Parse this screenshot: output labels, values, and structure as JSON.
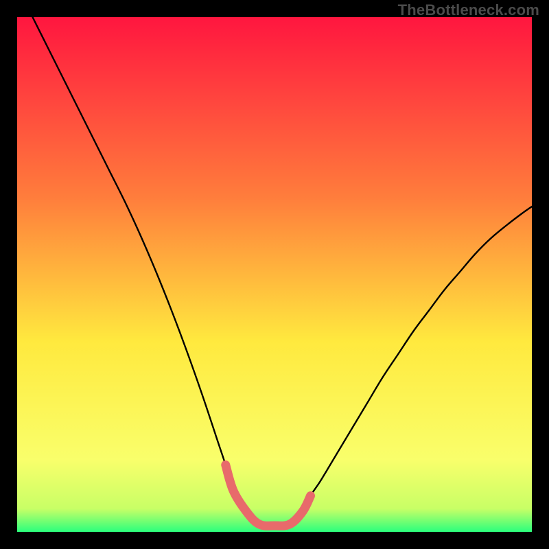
{
  "watermark": "TheBottleneck.com",
  "colors": {
    "background": "#000000",
    "gradient_top": "#ff163f",
    "gradient_mid1": "#ff7d3c",
    "gradient_mid2": "#ffe93e",
    "gradient_mid3": "#f9ff6b",
    "gradient_bottom": "#2bff7d",
    "curve": "#000000",
    "highlight": "#e86a6b",
    "watermark_text": "#4b4b4b"
  },
  "chart_data": {
    "type": "line",
    "title": "",
    "xlabel": "",
    "ylabel": "",
    "xlim": [
      0,
      1
    ],
    "ylim": [
      0,
      1
    ],
    "categories": [],
    "series": [
      {
        "name": "bottleneck-curve",
        "x": [
          0.03,
          0.06,
          0.09,
          0.12,
          0.15,
          0.18,
          0.21,
          0.24,
          0.27,
          0.3,
          0.33,
          0.36,
          0.39,
          0.405,
          0.42,
          0.445,
          0.47,
          0.5,
          0.53,
          0.555,
          0.57,
          0.59,
          0.62,
          0.65,
          0.68,
          0.71,
          0.74,
          0.77,
          0.8,
          0.83,
          0.86,
          0.89,
          0.92,
          0.95,
          0.98,
          1.0
        ],
        "y": [
          1.0,
          0.94,
          0.88,
          0.82,
          0.76,
          0.7,
          0.64,
          0.575,
          0.505,
          0.43,
          0.35,
          0.265,
          0.175,
          0.13,
          0.08,
          0.04,
          0.015,
          0.012,
          0.015,
          0.04,
          0.07,
          0.1,
          0.15,
          0.2,
          0.25,
          0.3,
          0.345,
          0.39,
          0.43,
          0.47,
          0.505,
          0.54,
          0.57,
          0.595,
          0.618,
          0.632
        ]
      },
      {
        "name": "bottom-highlight",
        "x": [
          0.405,
          0.42,
          0.445,
          0.47,
          0.5,
          0.53,
          0.555,
          0.57
        ],
        "y": [
          0.13,
          0.08,
          0.04,
          0.015,
          0.012,
          0.015,
          0.04,
          0.07
        ]
      }
    ]
  }
}
